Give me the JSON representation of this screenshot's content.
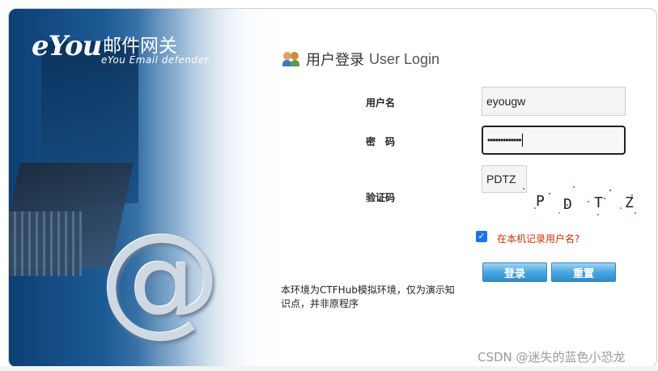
{
  "logo": {
    "brand": "eYou",
    "name_cn": "邮件网关",
    "subtitle": "eYou Email defender"
  },
  "login": {
    "title_cn": "用户登录",
    "title_en": "User Login",
    "title_icon": "users-icon",
    "username_label": "用户名",
    "username_value": "eyougw",
    "password_label": "密　码",
    "password_value": "•••••••••••••",
    "captcha_label": "验证码",
    "captcha_value": "PDTZ",
    "captcha_image_text": "P D T Z",
    "remember_checked": true,
    "remember_label": "在本机记录用户名?",
    "login_button": "登录",
    "reset_button": "重置",
    "notice": "本环境为CTFHub模拟环境，仅为演示知识点，并非原程序"
  },
  "watermark": "CSDN @迷失的蓝色小恐龙",
  "colors": {
    "button": "#2c8ccd",
    "remember_text": "#cc3300",
    "checkbox": "#1a73e8",
    "left_panel": "#1c5b95"
  }
}
